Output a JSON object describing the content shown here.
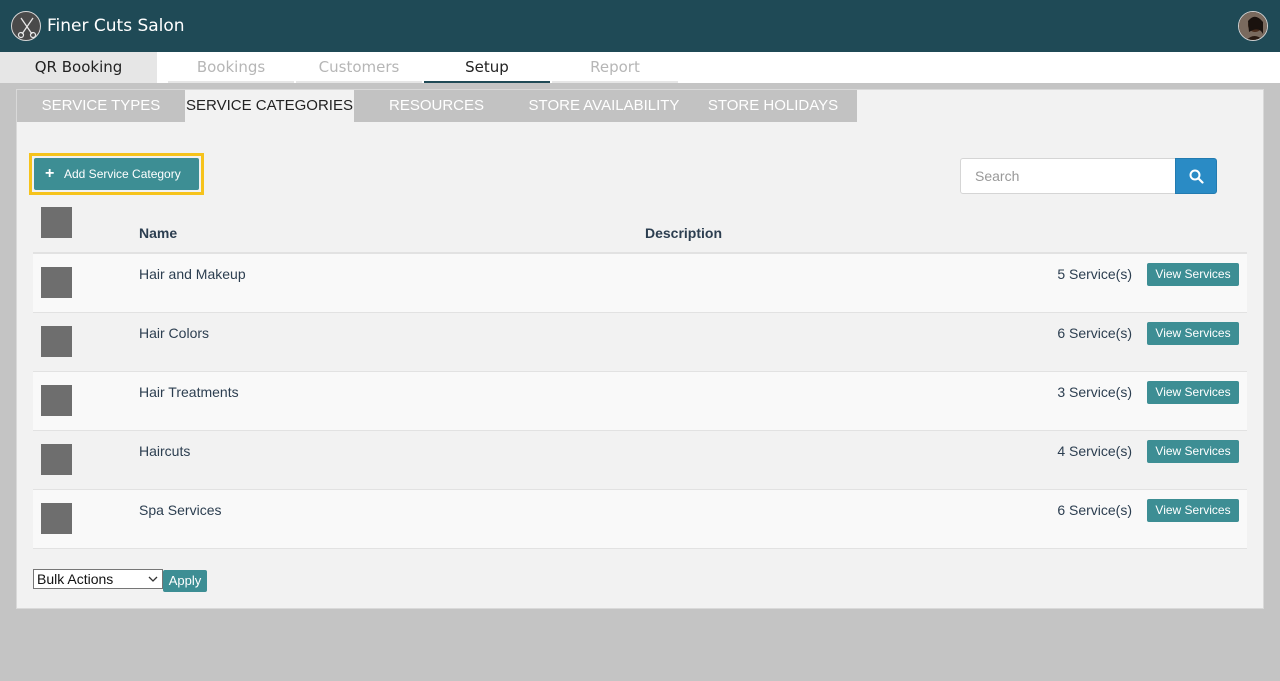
{
  "app": {
    "title": "Finer Cuts Salon"
  },
  "nav": {
    "tabs": [
      {
        "label": "QR Booking"
      },
      {
        "label": "Bookings"
      },
      {
        "label": "Customers"
      },
      {
        "label": "Setup"
      },
      {
        "label": "Report"
      }
    ],
    "active": "Setup"
  },
  "subtabs": [
    {
      "label": "SERVICE TYPES"
    },
    {
      "label": "SERVICE CATEGORIES"
    },
    {
      "label": "RESOURCES"
    },
    {
      "label": "STORE AVAILABILITY"
    },
    {
      "label": "STORE HOLIDAYS"
    }
  ],
  "toolbar": {
    "add_label": "Add Service Category",
    "search_placeholder": "Search"
  },
  "table": {
    "headers": {
      "name": "Name",
      "description": "Description"
    },
    "rows": [
      {
        "name": "Hair and Makeup",
        "count": "5 Service(s)",
        "action": "View Services"
      },
      {
        "name": "Hair Colors",
        "count": "6 Service(s)",
        "action": "View Services"
      },
      {
        "name": "Hair Treatments",
        "count": "3 Service(s)",
        "action": "View Services"
      },
      {
        "name": "Haircuts",
        "count": "4 Service(s)",
        "action": "View Services"
      },
      {
        "name": "Spa Services",
        "count": "6 Service(s)",
        "action": "View Services"
      }
    ]
  },
  "bulk": {
    "selected": "Bulk Actions",
    "apply_label": "Apply"
  },
  "colors": {
    "header_bg": "#1f4a56",
    "accent": "#3d8e94",
    "search_btn": "#2a8bc5",
    "highlight": "#f6c31c"
  }
}
